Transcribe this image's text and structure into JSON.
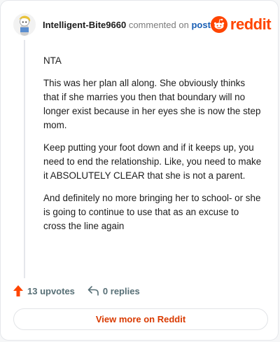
{
  "header": {
    "username": "Intelligent-Bite9660",
    "commented_on": "commented on",
    "post_link": "post",
    "brand": "reddit"
  },
  "comment": {
    "paragraphs": [
      "NTA",
      "This was her plan all along. She obviously thinks that if she marries you then that boundary will no longer exist because in her eyes she is now the step mom.",
      "Keep putting your foot down and if it keeps up, you need to end the relationship. Like, you need to make it ABSOLUTELY CLEAR that she is not a parent.",
      "And definitely no more bringing her to school- or she is going to continue to use that as an excuse to cross the line again"
    ]
  },
  "actions": {
    "upvotes": "13 upvotes",
    "replies": "0 replies"
  },
  "footer": {
    "view_more": "View more on Reddit"
  },
  "colors": {
    "brand": "#ff4500",
    "link": "#1a5fb4",
    "cta": "#d93a00"
  }
}
